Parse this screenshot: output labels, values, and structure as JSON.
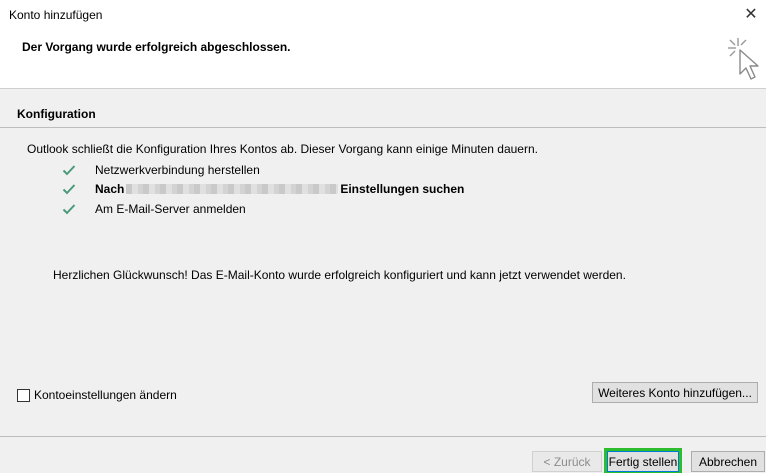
{
  "window": {
    "title": "Konto hinzufügen",
    "close_glyph": "✕"
  },
  "header": {
    "message": "Der Vorgang wurde erfolgreich abgeschlossen.",
    "icon": "wizard-cursor-icon"
  },
  "section": {
    "title": "Konfiguration"
  },
  "content": {
    "intro": "Outlook schließt die Konfiguration Ihres Kontos ab. Dieser Vorgang kann einige Minuten dauern.",
    "steps": [
      {
        "prefix": "Netzwerkverbindung herstellen",
        "suffix": "",
        "bold": false
      },
      {
        "prefix": "Nach",
        "suffix": "Einstellungen suchen",
        "bold": true
      },
      {
        "prefix": "Am E-Mail-Server anmelden",
        "suffix": "",
        "bold": false
      }
    ],
    "congrats": "Herzlichen Glückwunsch! Das E-Mail-Konto wurde erfolgreich konfiguriert und kann jetzt verwendet werden."
  },
  "options": {
    "change_settings_label": "Kontoeinstellungen ändern",
    "change_settings_checked": false,
    "add_account_label": "Weiteres Konto hinzufügen..."
  },
  "footer": {
    "back_label": "< Zurück",
    "finish_label": "Fertig stellen",
    "exit_label": "Abbrechen"
  },
  "colors": {
    "check": "#4a9a7a",
    "highlight": "#2ebd2e",
    "default_button_border": "#0078d7"
  }
}
